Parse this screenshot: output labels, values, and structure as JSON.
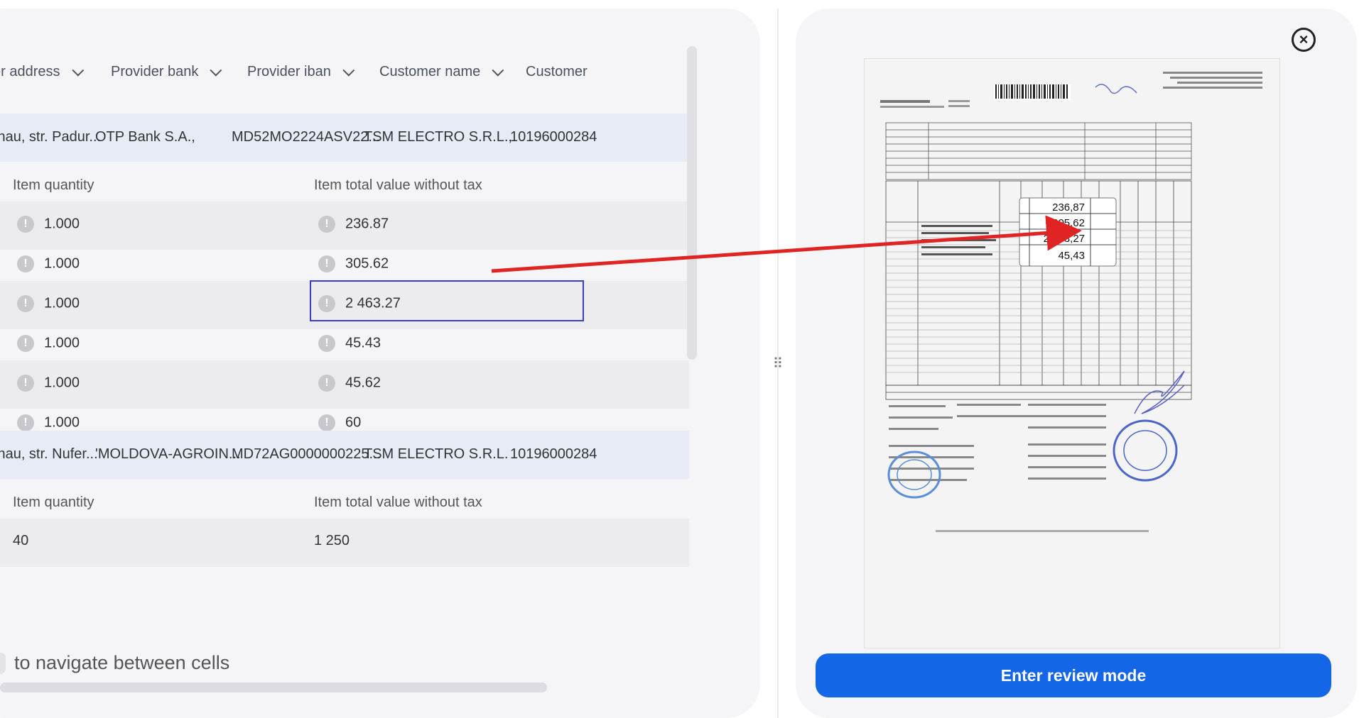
{
  "table": {
    "columns": [
      "er address",
      "Provider bank",
      "Provider iban",
      "Customer name",
      "Customer"
    ],
    "groups": [
      {
        "row": {
          "address": "inau, str. Padur...",
          "bank": "OTP Bank S.A.,",
          "iban": "MD52MO2224ASV22...",
          "customer_name": "TSM ELECTRO S.R.L.,",
          "customer": "10196000284"
        },
        "sub_headers": [
          "Item quantity",
          "Item total value without tax"
        ],
        "items": [
          {
            "quantity": "1.000",
            "total": "236.87"
          },
          {
            "quantity": "1.000",
            "total": "305.62"
          },
          {
            "quantity": "1.000",
            "total": "2 463.27"
          },
          {
            "quantity": "1.000",
            "total": "45.43"
          },
          {
            "quantity": "1.000",
            "total": "45.62"
          },
          {
            "quantity": "1.000",
            "total": "60"
          }
        ]
      },
      {
        "row": {
          "address": "inau, str. Nufer...",
          "bank": "'MOLDOVA-AGROIN...",
          "iban": "MD72AG0000000225...",
          "customer_name": "TSM ELECTRO S.R.L.",
          "customer": "10196000284"
        },
        "sub_headers": [
          "Item quantity",
          "Item total value without tax"
        ],
        "items": [
          {
            "quantity": "40",
            "total": "1 250"
          }
        ]
      }
    ],
    "warning_glyph": "!"
  },
  "hint": "to navigate between cells",
  "drag_handle_glyph": "⠿",
  "close_glyph": "×",
  "review_button": "Enter review mode",
  "document": {
    "zoomed_values": [
      "236,87",
      "305,62",
      "2 463,27",
      "45,43"
    ],
    "accent_color": "#e02424"
  },
  "colors": {
    "primary": "#1366e6",
    "selection": "#3a3ccc",
    "arrow": "#e02424",
    "row_highlight": "#e6ebf5"
  }
}
